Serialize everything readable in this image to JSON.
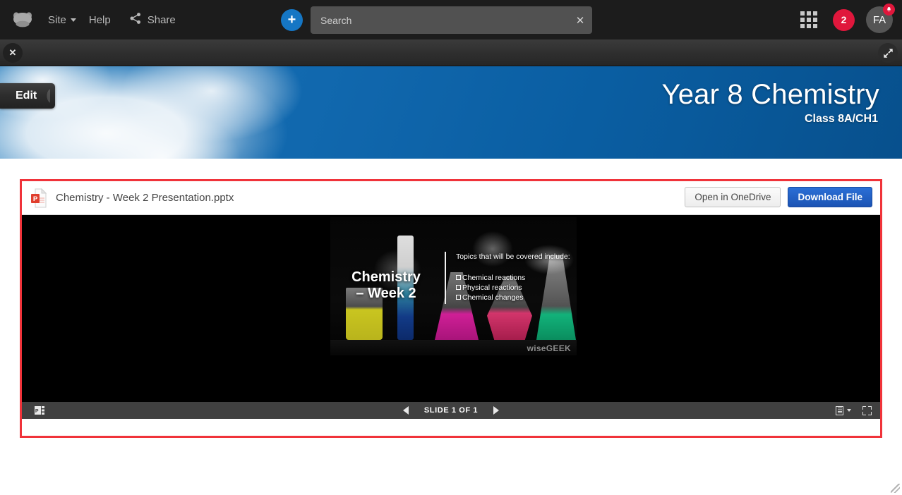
{
  "topnav": {
    "logo_icon": "cloud-logo-icon",
    "site_label": "Site",
    "help_label": "Help",
    "share_label": "Share",
    "share_icon": "share-icon",
    "add_label": "+",
    "apps_icon": "apps-grid-icon",
    "notification_count": "2",
    "avatar_initials": "FA",
    "bell_icon": "•",
    "background_color": "#1c1c1c"
  },
  "search": {
    "placeholder": "Search",
    "value": "",
    "clear_label": "✕"
  },
  "subbar": {
    "close_label": "✕",
    "expand_icon": "expand-arrows-icon"
  },
  "banner": {
    "edit_label": "Edit",
    "title": "Year 8 Chemistry",
    "subtitle": "Class 8A/CH1",
    "accent_color": "#0d66ad"
  },
  "embed": {
    "highlight_color": "#f0333a",
    "file_icon": "powerpoint-file-icon",
    "file_name": "Chemistry - Week 2 Presentation.pptx",
    "open_button": "Open in OneDrive",
    "download_button": "Download File",
    "download_color": "#1b53b4"
  },
  "slide": {
    "title": "Chemistry\n– Week 2",
    "lead": "Topics that will be covered include:",
    "bullets": [
      "Chemical reactions",
      "Physical reactions",
      "Chemical changes"
    ],
    "watermark": "wiseGEEK"
  },
  "viewer_toolbar": {
    "app_icon": "powerpoint-online-icon",
    "prev_icon": "previous-slide-icon",
    "counter": "SLIDE 1 OF 1",
    "next_icon": "next-slide-icon",
    "notes_icon": "notes-outline-icon",
    "fullscreen_icon": "fullscreen-icon",
    "background_color": "#404040"
  },
  "page": {
    "resize_grip_icon": "resize-grip-icon"
  }
}
